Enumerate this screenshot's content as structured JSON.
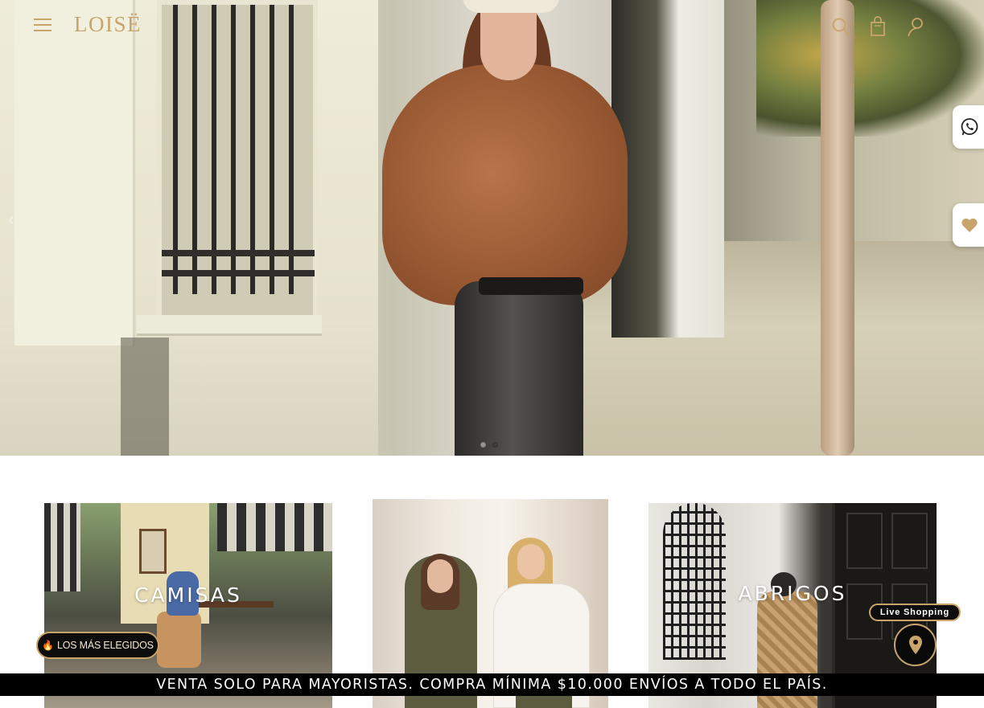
{
  "header": {
    "brand": "LOISË",
    "menu_icon": "hamburger-menu-icon",
    "search_icon": "search-icon",
    "cart_icon": "shopping-bag-icon",
    "account_icon": "user-icon",
    "accent_color": "#c8a46a"
  },
  "hero": {
    "prev_arrow": "‹",
    "slides": 2,
    "active_slide": 2
  },
  "side_buttons": {
    "whatsapp_icon": "whatsapp-icon",
    "favorites_icon": "heart-icon"
  },
  "categories": [
    {
      "label": "CAMISAS"
    },
    {
      "label": ""
    },
    {
      "label": "ABRIGOS"
    }
  ],
  "widgets": {
    "mas_elegidos_icon": "flame-icon",
    "mas_elegidos_label": "LOS MÁS ELEGIDOS",
    "live_label": "Live Shopping",
    "live_icon": "map-pin-icon"
  },
  "announcement": "VENTA SOLO PARA MAYORISTAS. COMPRA MÍNIMA $10.000 ENVÍOS A TODO EL PAÍS."
}
